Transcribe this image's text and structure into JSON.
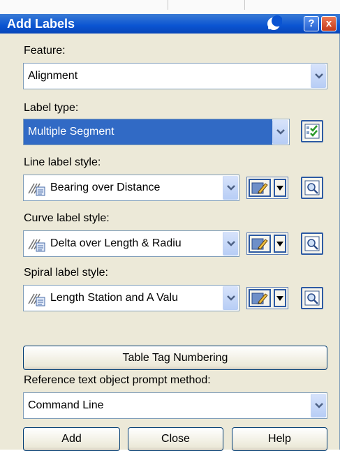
{
  "dialog": {
    "title": "Add Labels",
    "help_glyph": "?",
    "close_glyph": "x"
  },
  "feature": {
    "label": "Feature:",
    "value": "Alignment"
  },
  "label_type": {
    "label": "Label type:",
    "value": "Multiple Segment"
  },
  "line_label_style": {
    "label": "Line label style:",
    "value": "Bearing over Distance"
  },
  "curve_label_style": {
    "label": "Curve label style:",
    "value": "Delta over Length & Radiu"
  },
  "spiral_label_style": {
    "label": "Spiral label style:",
    "value": "Length Station and A Valu"
  },
  "table_tag_button": "Table Tag Numbering",
  "reference_prompt": {
    "label": "Reference text object prompt method:",
    "value": "Command Line"
  },
  "buttons": {
    "add": "Add",
    "close": "Close",
    "help": "Help"
  },
  "icons": {
    "autohide": "autohide-icon",
    "dropdown": "chevron-down-icon",
    "label_type_settings": "checklist-icon",
    "style": "label-style-icon",
    "edit": "edit-style-icon",
    "preview": "preview-style-icon"
  },
  "colors": {
    "titlebar": "#0a54d2",
    "selection": "#316ac5",
    "dialog_bg": "#ece9d8"
  }
}
